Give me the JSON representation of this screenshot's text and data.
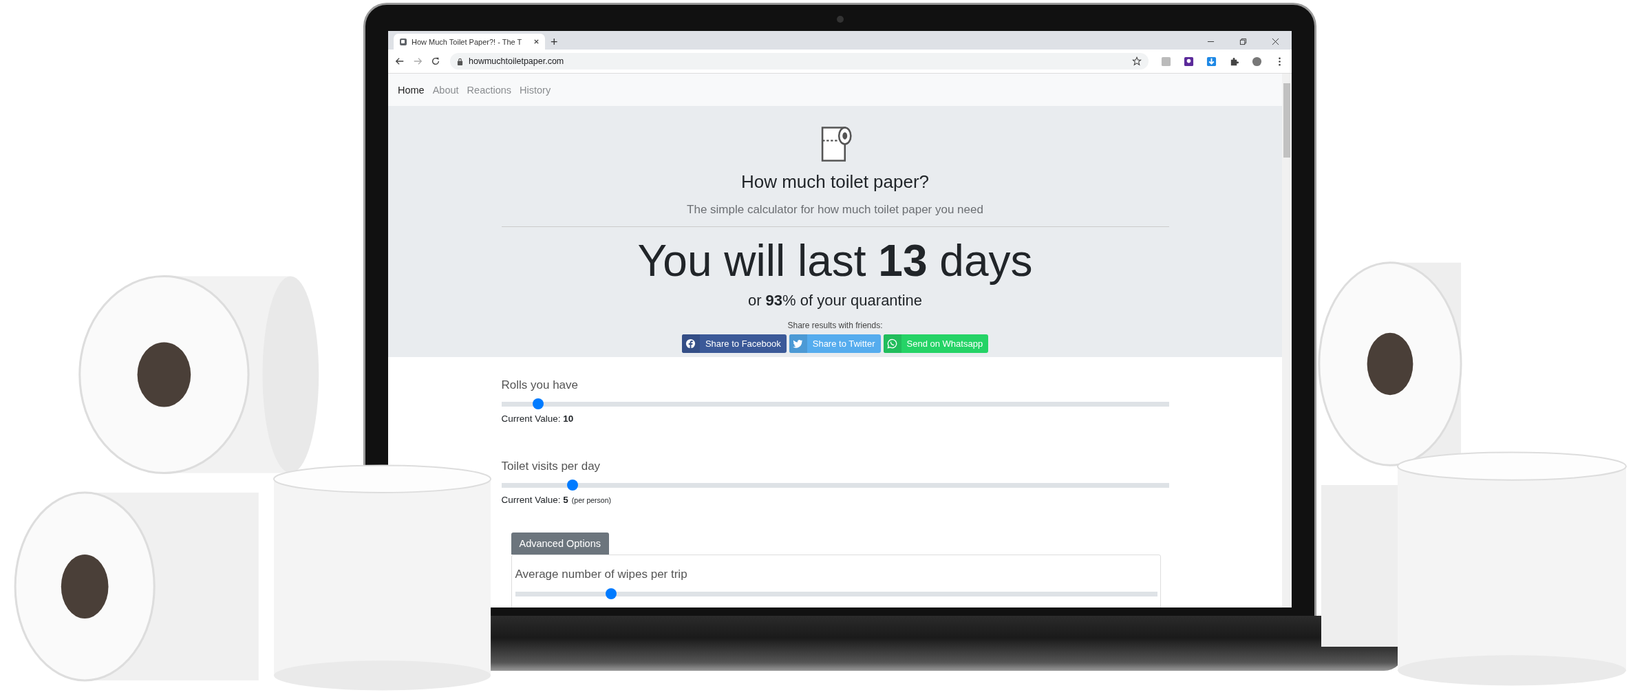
{
  "browser": {
    "tab_title": "How Much Toilet Paper?! - The T",
    "new_tab": "+",
    "url": "howmuchtoiletpaper.com"
  },
  "nav": [
    {
      "label": "Home",
      "selected": true
    },
    {
      "label": "About",
      "selected": false
    },
    {
      "label": "Reactions",
      "selected": false
    },
    {
      "label": "History",
      "selected": false
    }
  ],
  "hero": {
    "title": "How much toilet paper?",
    "subtitle": "The simple calculator for how much toilet paper you need",
    "result": "You will last **13** days",
    "quarantine": "or **93**% of your quarantine",
    "share_label": "Share results with friends:",
    "share_buttons": [
      {
        "kind": "facebook",
        "label": "Share to Facebook"
      },
      {
        "kind": "twitter",
        "label": "Share to Twitter"
      },
      {
        "kind": "whatsapp",
        "label": "Send on Whatsapp"
      }
    ]
  },
  "inputs": [
    {
      "label": "Rolls you have",
      "level": 0.055,
      "value": "Current Value: **10**"
    },
    {
      "label": "Toilet visits per day",
      "level": 0.107,
      "value": "Current Value: **5**",
      "note": "(per person)"
    }
  ],
  "advanced": {
    "button": "Advanced Options",
    "inputs": [
      {
        "label": "Average number of wipes per trip",
        "level": 0.15
      }
    ]
  }
}
